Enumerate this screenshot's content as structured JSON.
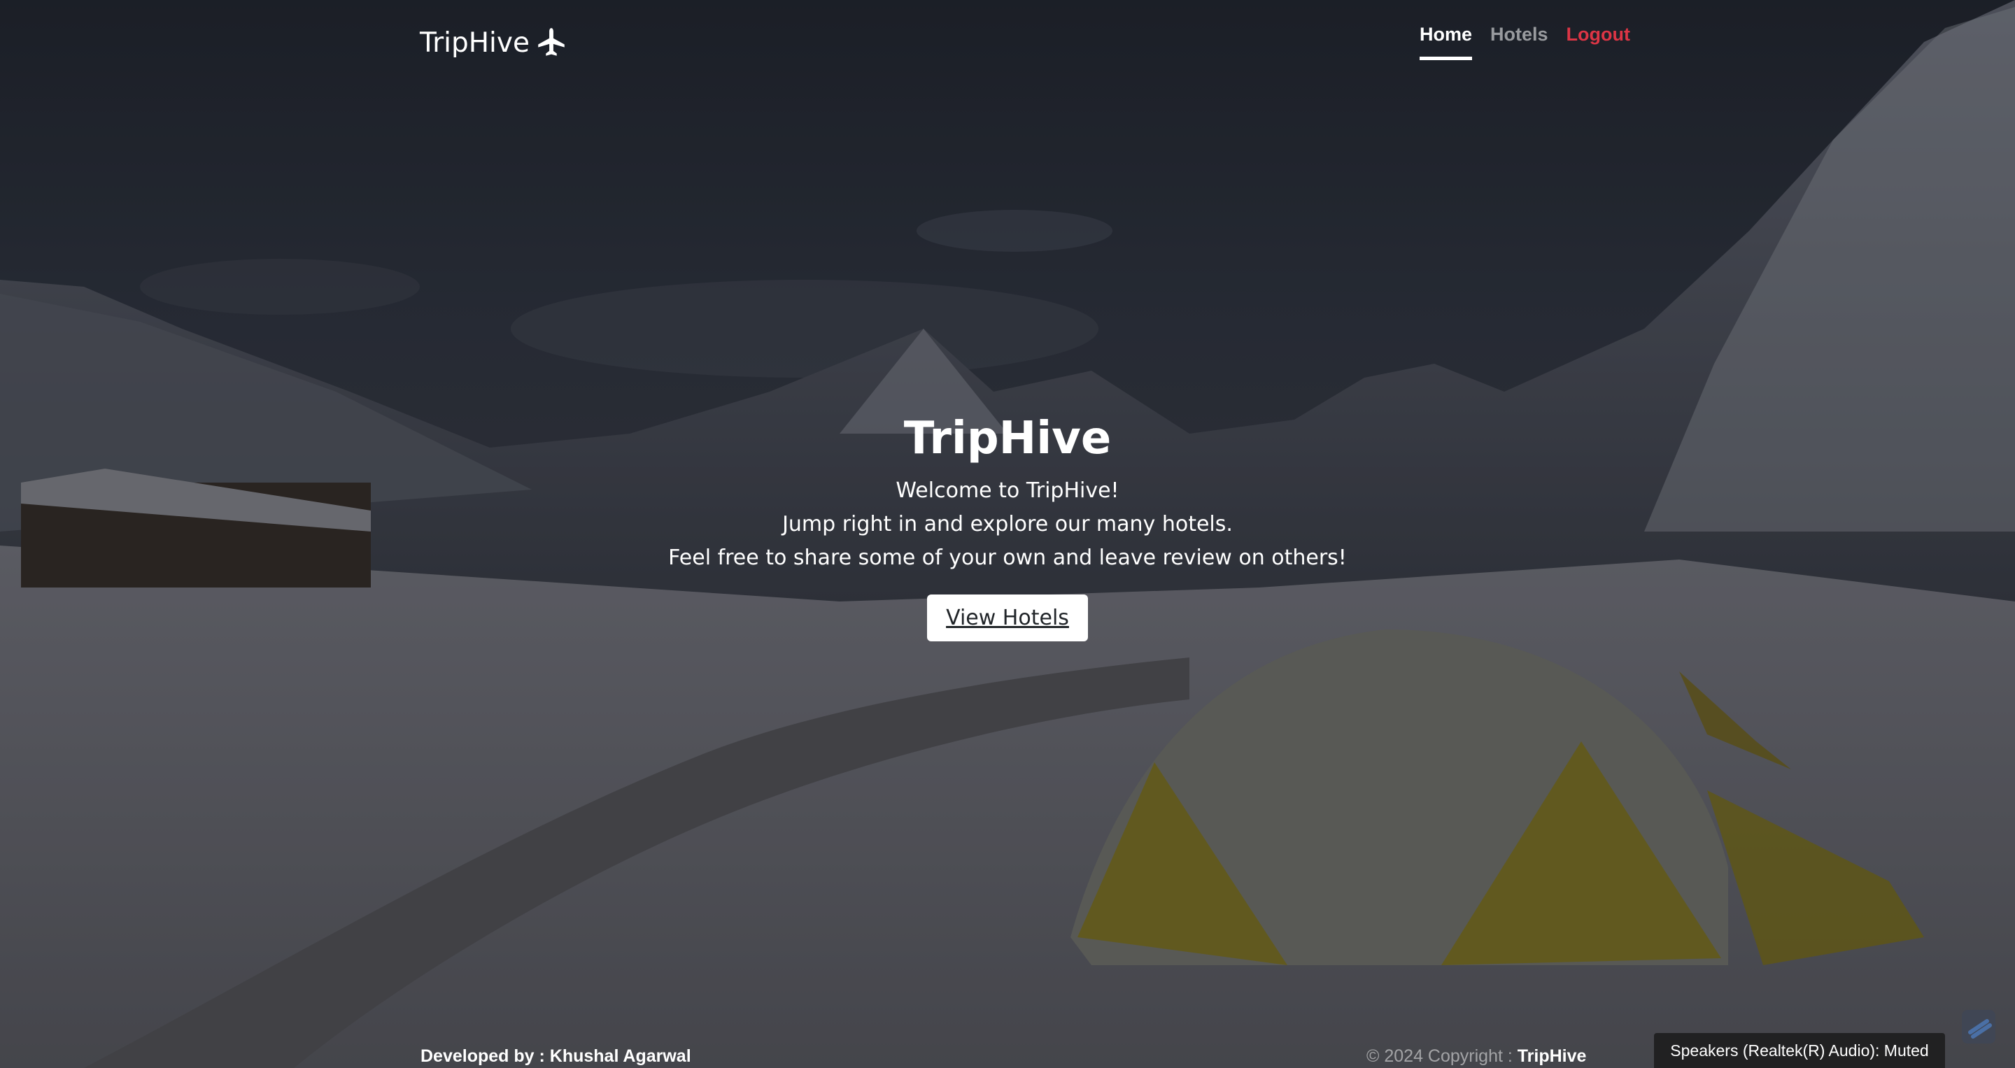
{
  "header": {
    "brand": "TripHive",
    "brand_icon": "airplane-icon",
    "nav": {
      "home": "Home",
      "hotels": "Hotels",
      "logout": "Logout"
    }
  },
  "hero": {
    "title": "TripHive",
    "lines": [
      "Welcome to TripHive!",
      "Jump right in and explore our many hotels.",
      "Feel free to share some of your own and leave review on others!"
    ],
    "button": "View Hotels"
  },
  "footer": {
    "developer": "Developed by : Khushal Agarwal",
    "copyright_prefix": "© 2024 Copyright : ",
    "copyright_brand": "TripHive"
  },
  "system_toast": "Speakers (Realtek(R) Audio): Muted",
  "colors": {
    "logout": "#dc3545",
    "button_bg": "#ffffff",
    "text": "#ffffff"
  }
}
